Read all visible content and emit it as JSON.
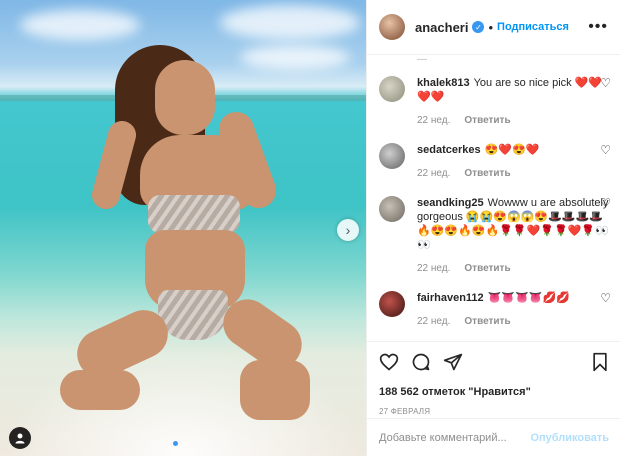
{
  "post": {
    "author": "anacheri",
    "follow_label": "Подписаться",
    "separator": "•",
    "more_label": "•••"
  },
  "comments": [
    {
      "user": "khalek813",
      "text": "You are so nice pick ❤️❤️❤️❤️",
      "time": "22 нед.",
      "reply": "Ответить"
    },
    {
      "user": "sedatcerkes",
      "text": "😍❤️😍❤️",
      "time": "22 нед.",
      "reply": "Ответить"
    },
    {
      "user": "seandking25",
      "text": "Wowww u are absolutely gorgeous 😭😭😍😱😱😍🎩🎩🎩🎩🔥😍😍🔥😍🔥🌹🌹❤️🌹🌹❤️🌹👀👀",
      "time": "22 нед.",
      "reply": "Ответить"
    },
    {
      "user": "fairhaven112",
      "text": "👅👅👅👅💋💋",
      "time": "22 нед.",
      "reply": "Ответить"
    }
  ],
  "actions": {
    "likes_text": "188 562 отметок \"Нравится\"",
    "date": "27 ФЕВРАЛЯ"
  },
  "composer": {
    "placeholder": "Добавьте комментарий...",
    "publish_label": "Опубликовать"
  },
  "carousel": {
    "next_label": "›",
    "current_slide": 1,
    "total_slides": 2
  },
  "colors": {
    "accent": "#0095f6",
    "publish_disabled": "#b2dffc",
    "meta": "#8e8e8e",
    "dot_active": "#3897f0"
  }
}
